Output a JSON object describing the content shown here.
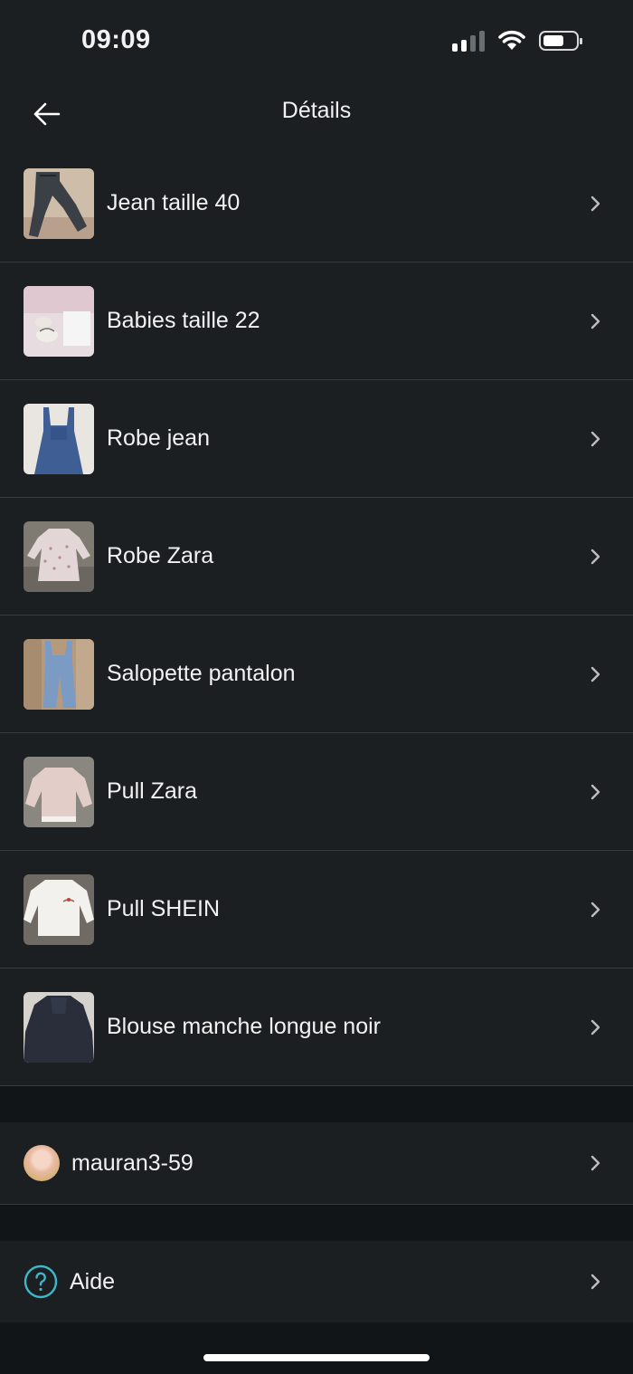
{
  "status_bar": {
    "time": "09:09",
    "signal_icon": "cellular-signal-icon",
    "wifi_icon": "wifi-icon",
    "battery_icon": "battery-icon"
  },
  "header": {
    "title": "Détails",
    "back_icon": "arrow-left-icon"
  },
  "items": [
    {
      "label": "Jean taille 40",
      "thumb": "jeans"
    },
    {
      "label": "Babies taille 22",
      "thumb": "shoes"
    },
    {
      "label": "Robe jean",
      "thumb": "denim-dress"
    },
    {
      "label": "Robe Zara",
      "thumb": "floral-dress"
    },
    {
      "label": "Salopette pantalon",
      "thumb": "overalls"
    },
    {
      "label": "Pull Zara",
      "thumb": "pink-sweater"
    },
    {
      "label": "Pull SHEIN",
      "thumb": "white-sweater"
    },
    {
      "label": "Blouse manche longue noir",
      "thumb": "black-blouse"
    }
  ],
  "user": {
    "name": "mauran3-59"
  },
  "help": {
    "label": "Aide",
    "icon": "help-circle-icon"
  },
  "colors": {
    "background": "#1b1f21",
    "separator": "#363b3e",
    "section_gap": "#121517",
    "help_accent": "#3fb6c9"
  }
}
